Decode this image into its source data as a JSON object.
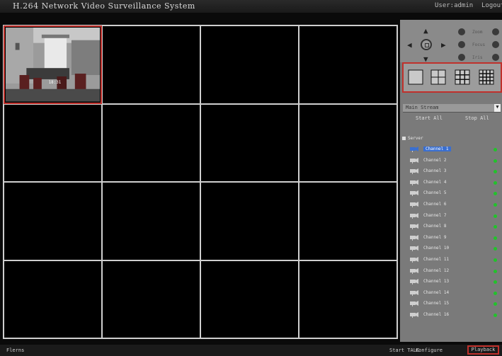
{
  "title": "H.264 Network Video Surveillance System",
  "user_label": "User:admin",
  "logout_label": "Logout",
  "stream": {
    "selected": "Main Stream"
  },
  "buttons": {
    "start_all": "Start All",
    "stop_all": "Stop All"
  },
  "tree_root": "Server",
  "channels": [
    "Channel 1",
    "Channel 2",
    "Channel 3",
    "Channel 4",
    "Channel 5",
    "Channel 6",
    "Channel 7",
    "Channel 8",
    "Channel 9",
    "Channel 10",
    "Channel 11",
    "Channel 12",
    "Channel 13",
    "Channel 14",
    "Channel 15",
    "Channel 16"
  ],
  "ptz": {
    "zoom_label": "Zoom",
    "focus_label": "Focus",
    "iris_label": "Iris"
  },
  "thumb_timestamp": "18:31",
  "bottom": {
    "left_text": "Flerns",
    "talk_label": "Start TALK",
    "configure_label": "Configure",
    "playback_label": "Playback"
  },
  "colors": {
    "accent_red": "#c0302b",
    "status_green": "#22c22b",
    "selected_blue": "#3a6fd0"
  }
}
